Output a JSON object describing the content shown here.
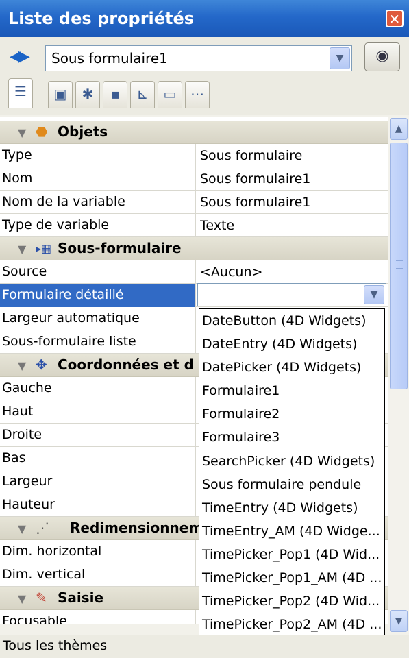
{
  "window": {
    "title": "Liste des propriétés"
  },
  "toolbar": {
    "object_name": "Sous formulaire1"
  },
  "sections": [
    {
      "label": "Objets",
      "icon": "cube-icon"
    },
    {
      "label": "Sous-formulaire",
      "icon": "subform-icon"
    },
    {
      "label": "Coordonnées et d",
      "icon": "move-icon"
    },
    {
      "label": "Redimensionnem",
      "icon": "resize-icon"
    },
    {
      "label": "Saisie",
      "icon": "entry-icon"
    }
  ],
  "properties": {
    "objets": [
      {
        "name": "Type",
        "value": "Sous formulaire"
      },
      {
        "name": "Nom",
        "value": "Sous formulaire1"
      },
      {
        "name": "Nom de la variable",
        "value": "Sous formulaire1"
      },
      {
        "name": "Type de variable",
        "value": "Texte"
      }
    ],
    "sous_formulaire": [
      {
        "name": "Source",
        "value": "<Aucun>"
      },
      {
        "name": "Formulaire détaillé",
        "value": ""
      },
      {
        "name": "Largeur automatique",
        "value": ""
      },
      {
        "name": "Sous-formulaire liste",
        "value": ""
      }
    ],
    "coordonnees": [
      {
        "name": "Gauche",
        "value": ""
      },
      {
        "name": "Haut",
        "value": ""
      },
      {
        "name": "Droite",
        "value": ""
      },
      {
        "name": "Bas",
        "value": ""
      },
      {
        "name": "Largeur",
        "value": ""
      },
      {
        "name": "Hauteur",
        "value": ""
      }
    ],
    "redimensionnement": [
      {
        "name": "Dim. horizontal",
        "value": ""
      },
      {
        "name": "Dim. vertical",
        "value": ""
      }
    ],
    "saisie": [
      {
        "name": "Focusable",
        "value": ""
      }
    ]
  },
  "dropdown_options": [
    "DateButton (4D Widgets)",
    "DateEntry (4D Widgets)",
    "DatePicker (4D Widgets)",
    "Formulaire1",
    "Formulaire2",
    "Formulaire3",
    "SearchPicker (4D Widgets)",
    "Sous formulaire pendule",
    "TimeEntry (4D Widgets)",
    "TimeEntry_AM (4D Widge...",
    "TimePicker_Pop1 (4D Wid...",
    "TimePicker_Pop1_AM (4D ...",
    "TimePicker_Pop2 (4D Wid...",
    "TimePicker_Pop2_AM (4D ..."
  ],
  "status": {
    "text": "Tous les thèmes"
  }
}
